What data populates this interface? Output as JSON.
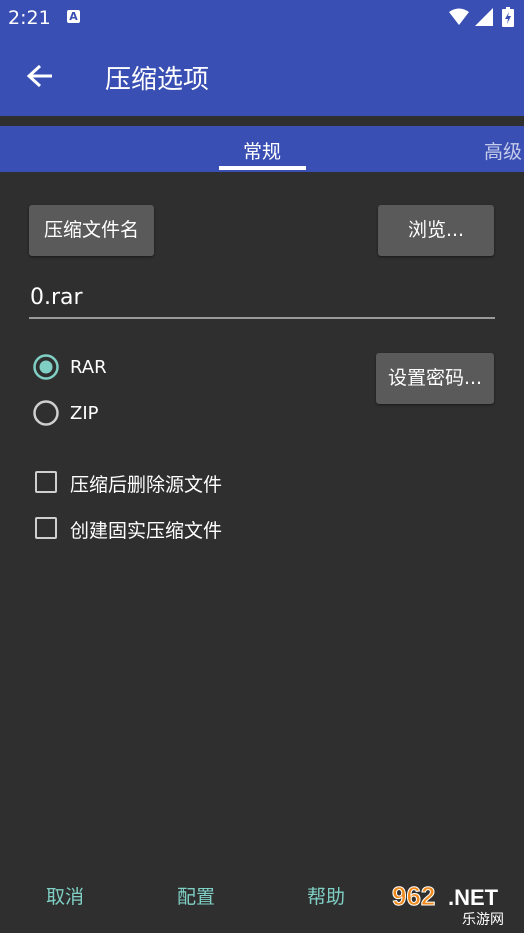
{
  "statusbar": {
    "time": "2:21",
    "notif_letter": "A"
  },
  "appbar": {
    "title": "压缩选项"
  },
  "tabs": [
    {
      "label": "常规"
    },
    {
      "label": "高级"
    }
  ],
  "buttons": {
    "archive_name": "压缩文件名",
    "browse": "浏览...",
    "set_password": "设置密码..."
  },
  "filename": {
    "value": "0.rar"
  },
  "format": {
    "options": [
      "RAR",
      "ZIP"
    ],
    "selected": "RAR"
  },
  "options": {
    "delete_after": {
      "label": "压缩后删除源文件",
      "checked": false
    },
    "solid": {
      "label": "创建固实压缩文件",
      "checked": false
    }
  },
  "footer": {
    "cancel": "取消",
    "config": "配置",
    "help": "帮助"
  },
  "watermark": {
    "top": "962.NET",
    "bottom": "乐游网"
  },
  "colors": {
    "primary": "#3a4fb3",
    "background": "#2f2f2f",
    "accent": "#7fcfc4",
    "button": "#5a5a5a"
  }
}
